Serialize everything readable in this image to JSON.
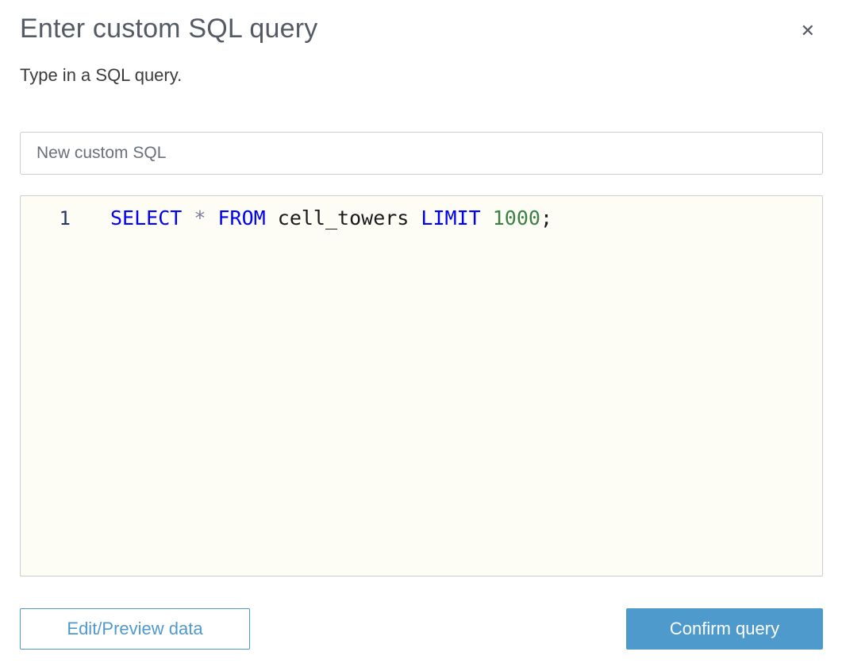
{
  "dialog": {
    "title": "Enter custom SQL query",
    "subtitle": "Type in a SQL query.",
    "close_icon": "✕"
  },
  "name_input": {
    "value": "New custom SQL"
  },
  "editor": {
    "line_number": "1",
    "tokens": [
      {
        "text": "SELECT",
        "type": "keyword"
      },
      {
        "text": " ",
        "type": "plain"
      },
      {
        "text": "*",
        "type": "operator"
      },
      {
        "text": " ",
        "type": "plain"
      },
      {
        "text": "FROM",
        "type": "keyword"
      },
      {
        "text": " ",
        "type": "plain"
      },
      {
        "text": "cell_towers",
        "type": "identifier"
      },
      {
        "text": " ",
        "type": "plain"
      },
      {
        "text": "LIMIT",
        "type": "keyword"
      },
      {
        "text": " ",
        "type": "plain"
      },
      {
        "text": "1000",
        "type": "number"
      },
      {
        "text": ";",
        "type": "punctuation"
      }
    ]
  },
  "buttons": {
    "edit_preview": "Edit/Preview data",
    "confirm": "Confirm query"
  },
  "colors": {
    "accent": "#4f9acd",
    "keyword": "#0000f5",
    "operator": "#7b7ba3",
    "identifier": "#1a1a1a",
    "number": "#3b8144",
    "punctuation": "#1a1a1a",
    "line-number": "#24356e",
    "editor-bg": "#fdfcf5",
    "border": "#cccccc",
    "title": "#545b64",
    "subtitle": "#3b3b3b",
    "input-text": "#687078"
  }
}
